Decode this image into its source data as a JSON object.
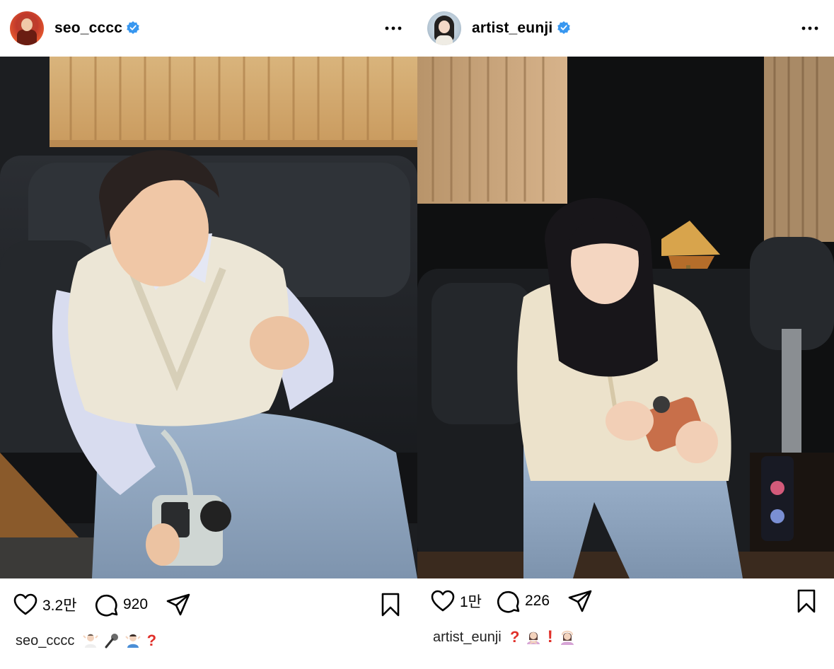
{
  "posts": [
    {
      "username": "seo_cccc",
      "verified": true,
      "likes": "3.2만",
      "comments": "920",
      "caption_user": "seo_cccc",
      "caption_emojis": [
        "person-shrugging-light",
        "microphone",
        "person-shrugging-blue",
        "question-mark"
      ],
      "photo_description_icon": "man-on-sofa-with-instant-camera"
    },
    {
      "username": "artist_eunji",
      "verified": true,
      "likes": "1만",
      "comments": "226",
      "caption_user": "artist_eunji",
      "caption_emojis": [
        "question-mark",
        "person-gesturing-no",
        "exclamation-mark",
        "person-gesturing-ok"
      ],
      "photo_description_icon": "woman-on-sofa-with-instant-camera"
    }
  ],
  "colors": {
    "verified": "#3897f0",
    "accent_red": "#e0302a",
    "text": "#000000"
  }
}
